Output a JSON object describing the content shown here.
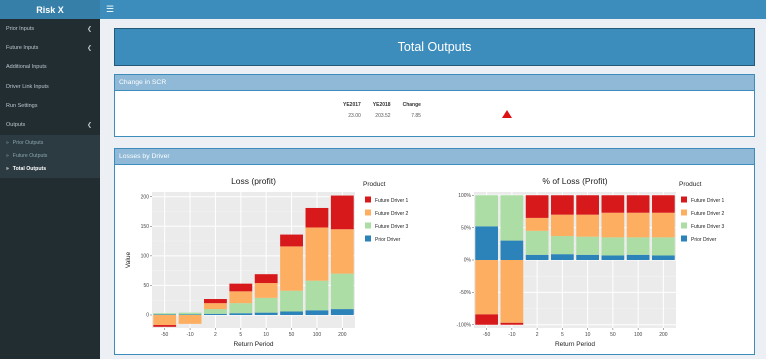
{
  "app": {
    "title": "Risk X"
  },
  "sidebar": {
    "items": [
      {
        "label": "Prior Inputs",
        "chevron": true
      },
      {
        "label": "Future Inputs",
        "chevron": true
      },
      {
        "label": "Additional Inputs",
        "chevron": false
      },
      {
        "label": "Driver Link Inputs",
        "chevron": false
      },
      {
        "label": "Run Settings",
        "chevron": false
      },
      {
        "label": "Outputs",
        "chevron": true,
        "open": true
      }
    ],
    "subitems": [
      {
        "label": "Prior Outputs",
        "active": false
      },
      {
        "label": "Future Outputs",
        "active": false
      },
      {
        "label": "Total Outputs",
        "active": true
      }
    ]
  },
  "page": {
    "title": "Total Outputs"
  },
  "scr": {
    "header": "Change in SCR",
    "columns": [
      "YE2017",
      "YE2018",
      "Change"
    ],
    "values": [
      "23.00",
      "203.52",
      "7.85"
    ],
    "indicator": "up-triangle-red"
  },
  "losses": {
    "header": "Losses by Driver"
  },
  "colors": {
    "Future Driver 1": "#d7191c",
    "Future Driver 2": "#fdae61",
    "Future Driver 3": "#abdda4",
    "Prior Driver": "#2b83ba"
  },
  "chart_data": [
    {
      "type": "bar",
      "title": "Loss (profit)",
      "xlabel": "Return Period",
      "ylabel": "Value",
      "categories": [
        "-50",
        "-10",
        "2",
        "5",
        "10",
        "50",
        "100",
        "200"
      ],
      "ylim": [
        -22,
        208
      ],
      "yticks": [
        0,
        50,
        100,
        150,
        200
      ],
      "ytick_labels": [
        "0",
        "50",
        "100",
        "150",
        "200"
      ],
      "legend_title": "Product",
      "legend_position": "right",
      "series": [
        {
          "name": "Future Driver 1",
          "values": [
            -3,
            0,
            7,
            13,
            15,
            20,
            33,
            57
          ]
        },
        {
          "name": "Future Driver 2",
          "values": [
            -17,
            -15,
            10,
            20,
            25,
            75,
            90,
            75
          ]
        },
        {
          "name": "Future Driver 3",
          "values": [
            2,
            3,
            8,
            17,
            25,
            35,
            50,
            60
          ]
        },
        {
          "name": "Prior Driver",
          "values": [
            1,
            1,
            2,
            3,
            4,
            6,
            8,
            10
          ]
        }
      ]
    },
    {
      "type": "bar",
      "title": "% of Loss (Profit)",
      "xlabel": "Return Period",
      "ylabel": "",
      "categories": [
        "-50",
        "-10",
        "2",
        "5",
        "10",
        "50",
        "100",
        "200"
      ],
      "ylim": [
        -1.05,
        1.05
      ],
      "yticks": [
        1,
        0.5,
        0,
        -0.5,
        -1
      ],
      "ytick_labels": [
        "100%",
        "50%",
        "0%",
        "-50%",
        "-100%"
      ],
      "legend_title": "Product",
      "legend_position": "right",
      "series": [
        {
          "name": "Future Driver 1",
          "values": [
            -0.16,
            -0.03,
            0.35,
            0.3,
            0.3,
            0.27,
            0.27,
            0.27
          ]
        },
        {
          "name": "Future Driver 2",
          "values": [
            -0.84,
            -0.97,
            0.2,
            0.33,
            0.34,
            0.38,
            0.38,
            0.38
          ]
        },
        {
          "name": "Future Driver 3",
          "values": [
            0.48,
            0.7,
            0.37,
            0.28,
            0.28,
            0.28,
            0.27,
            0.28
          ]
        },
        {
          "name": "Prior Driver",
          "values": [
            0.52,
            0.3,
            0.08,
            0.09,
            0.08,
            0.07,
            0.08,
            0.07
          ]
        }
      ]
    }
  ]
}
